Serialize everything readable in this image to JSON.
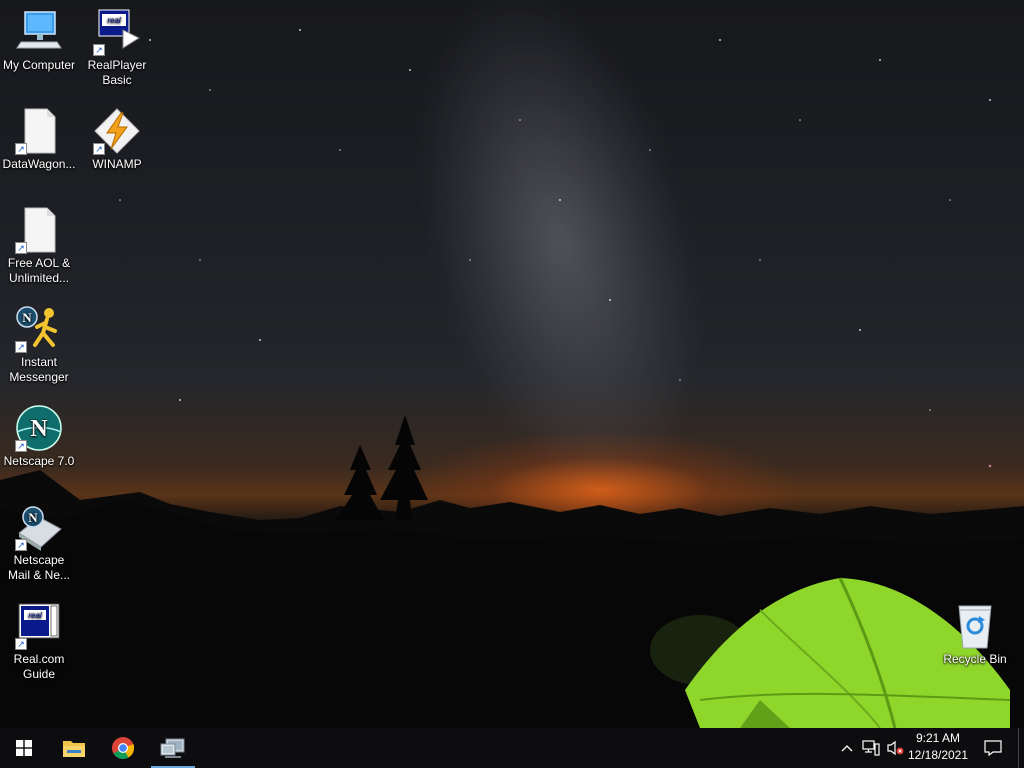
{
  "desktop_icons": [
    {
      "label": "My Computer",
      "icon": "computer-icon"
    },
    {
      "label": "RealPlayer Basic",
      "icon": "realplayer-icon"
    },
    {
      "label": "DataWagon...",
      "icon": "blank-document-icon"
    },
    {
      "label": "WINAMP",
      "icon": "winamp-icon"
    },
    {
      "label": "Free AOL & Unlimited...",
      "icon": "blank-document-icon"
    },
    {
      "label": "Instant Messenger",
      "icon": "aim-running-man-icon"
    },
    {
      "label": "Netscape 7.0",
      "icon": "netscape-icon"
    },
    {
      "label": "Netscape Mail & Ne...",
      "icon": "netscape-mail-icon"
    },
    {
      "label": "Real.com Guide",
      "icon": "real-guide-icon"
    },
    {
      "label": "Recycle Bin",
      "icon": "recycle-bin-icon"
    }
  ],
  "taskbar": {
    "pinned": [
      {
        "name": "start",
        "icon": "windows-start-icon"
      },
      {
        "name": "file-explorer",
        "icon": "folder-icon"
      },
      {
        "name": "chrome",
        "icon": "chrome-icon"
      },
      {
        "name": "display-app",
        "icon": "monitor-app-icon",
        "active": true
      }
    ],
    "tray": {
      "icons": [
        "chevron-up-icon",
        "network-icon",
        "volume-muted-icon",
        "notification-icon"
      ],
      "time": "9:21 AM",
      "date": "12/18/2021"
    }
  },
  "colors": {
    "taskbar": "#0d0d0f",
    "active_indicator": "#6fa8dc",
    "tent": "#8fd62a"
  }
}
